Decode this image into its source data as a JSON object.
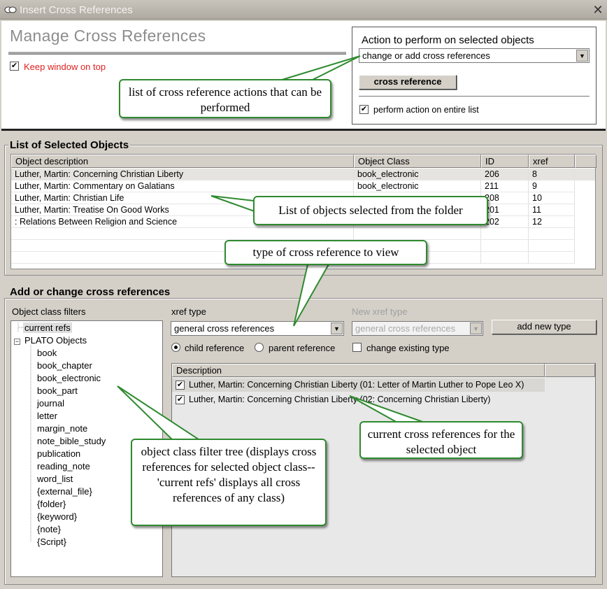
{
  "window": {
    "title": "Insert Cross References",
    "close_label": "✕"
  },
  "header": {
    "title": "Manage Cross References",
    "keep_on_top_label": "Keep window on top",
    "keep_on_top_checked": true
  },
  "action": {
    "title": "Action to perform on selected objects",
    "selected_action": "change or add cross references",
    "button_label": "cross reference",
    "entire_list_label": "perform action on entire list",
    "entire_list_checked": true
  },
  "selected_objects": {
    "group_label": "List of Selected Objects",
    "columns": [
      "Object description",
      "Object Class",
      "ID",
      "xref"
    ],
    "rows": [
      [
        "Luther, Martin: Concerning Christian Liberty",
        "book_electronic",
        "206",
        "8"
      ],
      [
        "Luther, Martin: Commentary on Galatians",
        "book_electronic",
        "211",
        "9"
      ],
      [
        "Luther, Martin: Christian Life",
        "",
        "208",
        "10"
      ],
      [
        "Luther, Martin: Treatise On Good Works",
        "",
        "201",
        "11"
      ],
      [
        ": Relations Between Religion and Science",
        "",
        "202",
        "12"
      ]
    ]
  },
  "xrefs": {
    "group_label": "Add or change cross references",
    "filters_label": "Object class filters",
    "tree_root_current": "current refs",
    "tree_root_plato": "PLATO Objects",
    "tree_children": [
      "book",
      "book_chapter",
      "book_electronic",
      "book_part",
      "journal",
      "letter",
      "margin_note",
      "note_bible_study",
      "publication",
      "reading_note",
      "word_list",
      "{external_file}",
      "{folder}",
      "{keyword}",
      "{note}",
      "{Script}"
    ],
    "xref_type_label": "xref type",
    "xref_type_value": "general cross references",
    "new_xref_type_label": "New xref type",
    "new_xref_type_value": "general cross references",
    "add_new_type_label": "add new type",
    "child_ref_label": "child reference",
    "parent_ref_label": "parent reference",
    "change_type_label": "change existing type",
    "desc_header": "Description",
    "desc_rows": [
      "Luther, Martin: Concerning Christian Liberty (01: Letter of Martin Luther to Pope Leo X)",
      "Luther, Martin: Concerning Christian Liberty (02: Concerning Christian Liberty)"
    ]
  },
  "callouts": {
    "actions": "list of cross reference actions that can be performed",
    "objects": "List of objects selected from the folder",
    "type_view": "type of cross reference to view",
    "current": "current cross references for the selected object",
    "tree": "object class filter tree (displays cross references for selected object class--'current refs' displays all cross references of any class)"
  },
  "colors": {
    "callout_border": "#2f8a2f",
    "keep_on_top_text": "#e02020"
  }
}
